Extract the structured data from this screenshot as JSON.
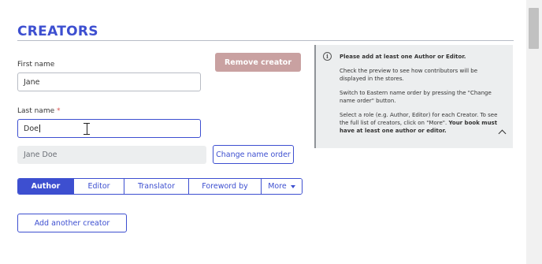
{
  "section": {
    "title": "CREATORS"
  },
  "form": {
    "first_name_label": "First name",
    "first_name_value": "Jane",
    "last_name_label": "Last name",
    "required_mark": "*",
    "last_name_value": "Doe",
    "preview_value": "Jane Doe",
    "change_order_button": "Change name order",
    "remove_button": "Remove creator",
    "add_another_button": "Add another creator"
  },
  "roles": {
    "items": [
      "Author",
      "Editor",
      "Translator",
      "Foreword by",
      "More"
    ],
    "active": "Author"
  },
  "info": {
    "line1": "Please add at least one Author or Editor.",
    "line2": "Check the preview to see how contributors will be displayed in the stores.",
    "line3": "Switch to Eastern name order by pressing the \"Change name order\" button.",
    "line4a": "Select a role (e.g. Author, Editor) for each Creator. To see the full list of creators, click on \"More\".",
    "line4b": "Your book must have at least one author or editor."
  },
  "colors": {
    "accent": "#3d4fd0",
    "remove_disabled": "#c9a1a1",
    "info_bg": "#eceeef"
  },
  "icons": {
    "info": "info-circle-icon",
    "collapse": "chevron-up-icon",
    "more": "caret-down-icon"
  }
}
